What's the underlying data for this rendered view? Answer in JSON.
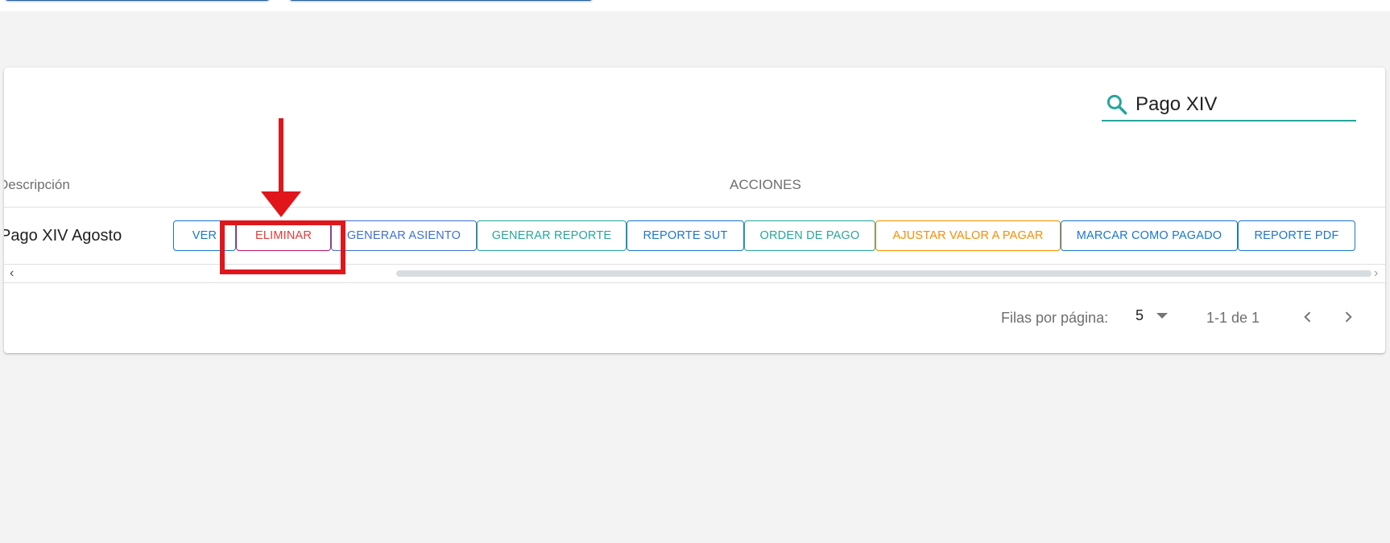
{
  "search": {
    "value": "Pago XIV",
    "icon": "search-icon",
    "accent_color": "#26a69a"
  },
  "table": {
    "headers": {
      "description": "Descripción",
      "actions": "ACCIONES"
    },
    "rows": [
      {
        "description": "Pago XIV Agosto",
        "actions": [
          {
            "label": "VER",
            "color": "#1976d2"
          },
          {
            "label": "ELIMINAR",
            "color": "#e53935",
            "border": "#c2185b"
          },
          {
            "label": "GENERAR ASIENTO",
            "color": "#3f6fd8"
          },
          {
            "label": "GENERAR REPORTE",
            "color": "#26a69a"
          },
          {
            "label": "REPORTE SUT",
            "color": "#1976d2"
          },
          {
            "label": "ORDEN DE PAGO",
            "color": "#26a69a"
          },
          {
            "label": "AJUSTAR VALOR A PAGAR",
            "color": "#fb8c00"
          },
          {
            "label": "MARCAR COMO PAGADO",
            "color": "#1976d2"
          },
          {
            "label": "REPORTE PDF",
            "color": "#1976d2"
          }
        ]
      }
    ]
  },
  "pagination": {
    "rows_per_page_label": "Filas por página:",
    "rows_per_page_value": "5",
    "range_text": "1-1 de 1",
    "prev_icon": "chevron-left-icon",
    "next_icon": "chevron-right-icon"
  },
  "annotation": {
    "highlight_color": "#e0161b",
    "target": "ELIMINAR"
  }
}
